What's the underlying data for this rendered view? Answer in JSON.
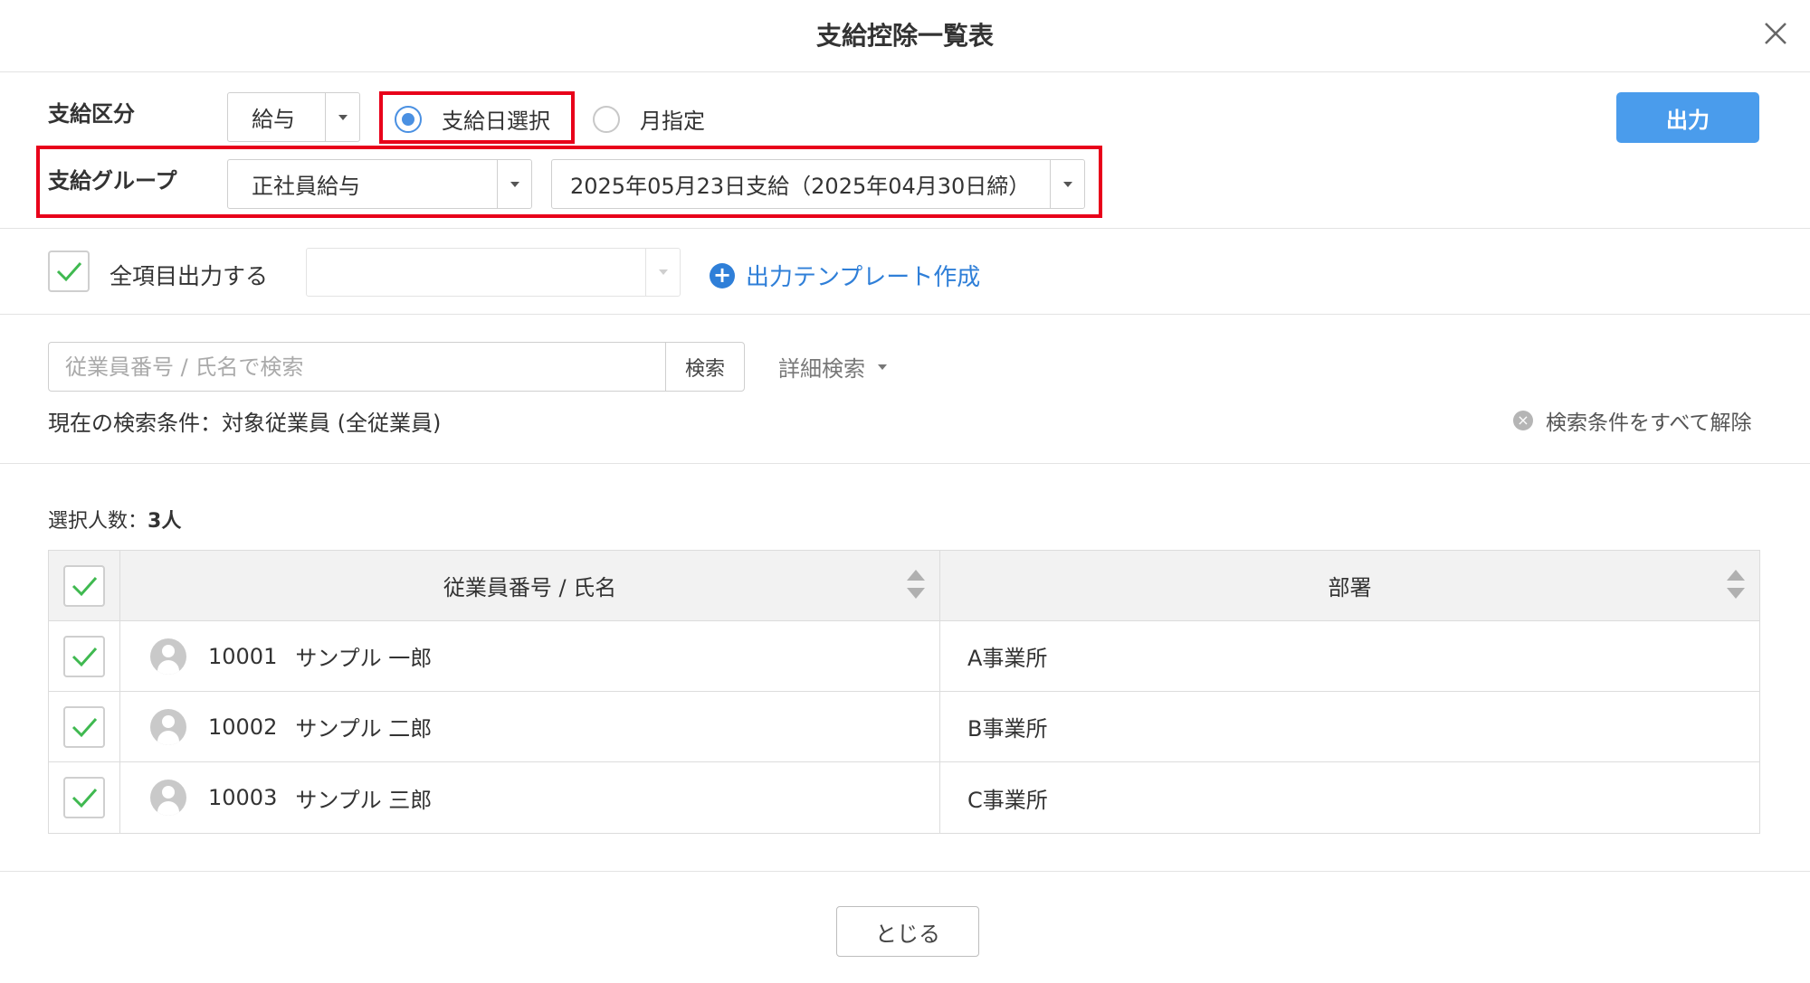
{
  "dialog": {
    "title": "支給控除一覧表"
  },
  "form": {
    "payment_type_label": "支給区分",
    "payment_type_value": "給与",
    "radio_paydate_label": "支給日選択",
    "radio_month_label": "月指定",
    "radio_selected": "paydate",
    "group_label": "支給グループ",
    "group_value": "正社員給与",
    "paydate_value": "2025年05月23日支給（2025年04月30日締）",
    "output_button": "出力"
  },
  "options": {
    "all_items_label": "全項目出力する",
    "all_items_checked": true,
    "template_value": "",
    "create_template_link": "出力テンプレート作成"
  },
  "search": {
    "placeholder": "従業員番号 / 氏名で検索",
    "button": "検索",
    "advanced": "詳細検索",
    "current_condition": "現在の検索条件：対象従業員 (全従業員)",
    "clear_all": "検索条件をすべて解除"
  },
  "selection": {
    "label": "選択人数：",
    "count": "3人"
  },
  "table": {
    "columns": [
      "従業員番号 / 氏名",
      "部署"
    ],
    "rows": [
      {
        "id": "10001",
        "name": "サンプル 一郎",
        "dept": "A事業所",
        "checked": true
      },
      {
        "id": "10002",
        "name": "サンプル 二郎",
        "dept": "B事業所",
        "checked": true
      },
      {
        "id": "10003",
        "name": "サンプル 三郎",
        "dept": "C事業所",
        "checked": true
      }
    ]
  },
  "footer": {
    "close_button": "とじる"
  },
  "colors": {
    "accent_blue": "#4a9cec",
    "link_blue": "#2f7fd8",
    "highlight_red": "#e8001a",
    "check_green": "#3fb950"
  }
}
